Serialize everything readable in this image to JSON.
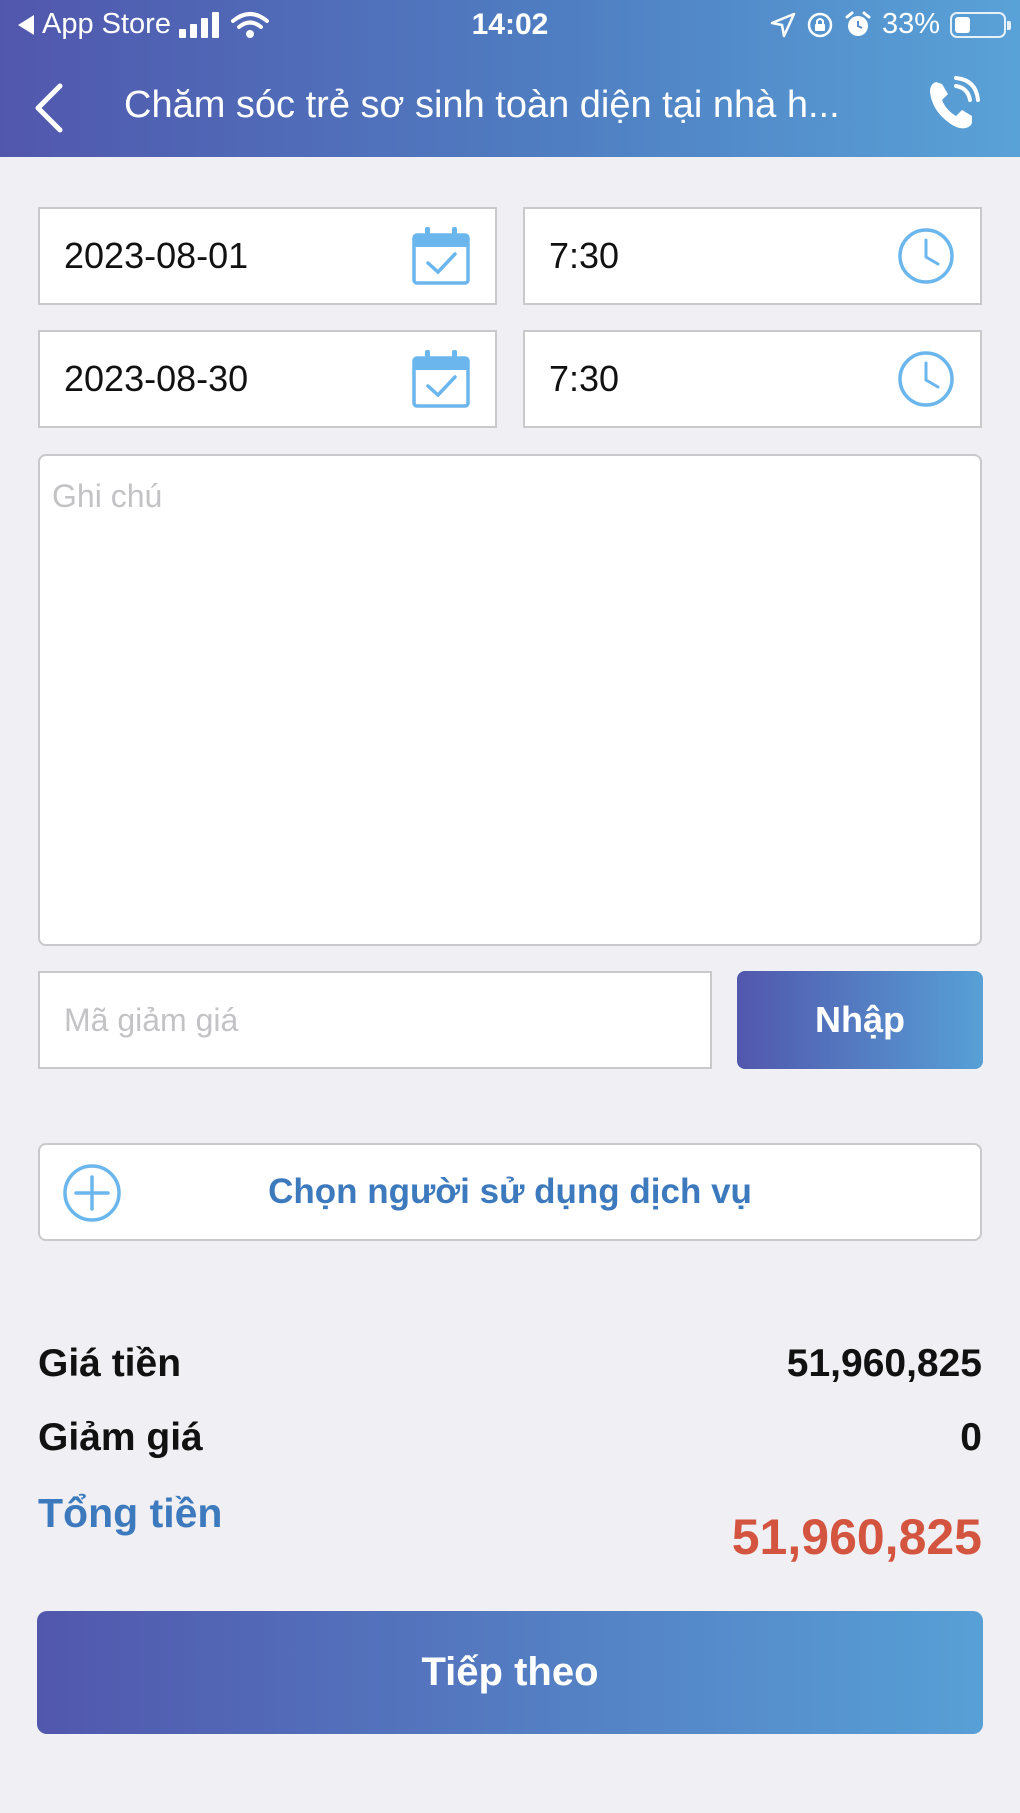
{
  "status_bar": {
    "back_app": "App Store",
    "time": "14:02",
    "battery": "33%",
    "battery_level": 0.33
  },
  "nav": {
    "title": "Chăm sóc trẻ sơ sinh toàn diện tại nhà h..."
  },
  "schedule": {
    "start_date": "2023-08-01",
    "start_time": "7:30",
    "end_date": "2023-08-30",
    "end_time": "7:30"
  },
  "note": {
    "placeholder": "Ghi chú"
  },
  "coupon": {
    "placeholder": "Mã giảm giá",
    "apply_label": "Nhập"
  },
  "user_select": {
    "label": "Chọn người sử dụng dịch vụ"
  },
  "summary": {
    "price_label": "Giá tiền",
    "price_value": "51,960,825",
    "discount_label": "Giảm giá",
    "discount_value": "0",
    "total_label": "Tổng tiền",
    "total_value": "51,960,825"
  },
  "next_button": {
    "label": "Tiếp theo"
  },
  "colors": {
    "accent_blue": "#3d7abd",
    "total_red": "#d4553f",
    "gradient_start": "#5157ad",
    "gradient_end": "#57a0d6",
    "icon_blue": "#6bb6ec"
  },
  "icons": {
    "calendar": "calendar-check-icon",
    "clock": "clock-icon",
    "plus": "plus-circle-icon",
    "phone": "phone-call-icon",
    "back": "chevron-left-icon"
  }
}
